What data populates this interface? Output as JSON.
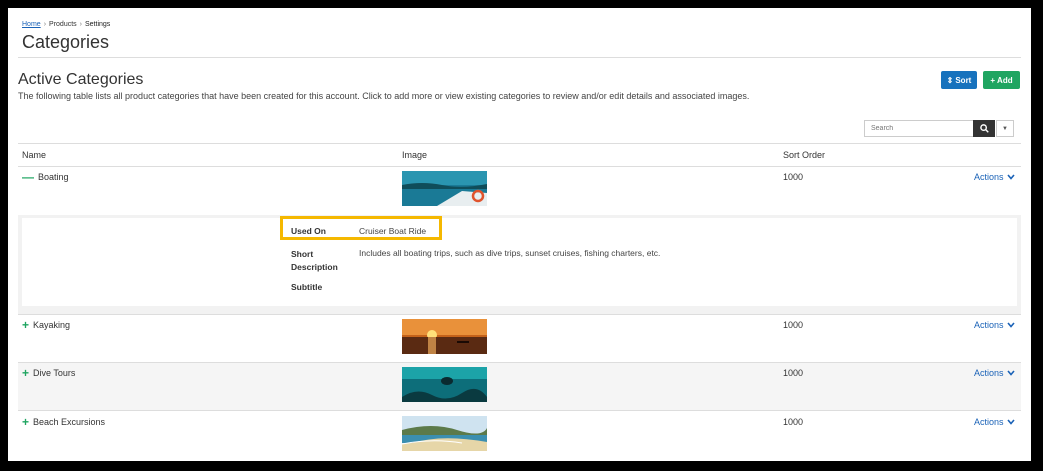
{
  "breadcrumb": {
    "home": "Home",
    "products": "Products",
    "settings": "Settings"
  },
  "page": {
    "title": "Categories"
  },
  "section": {
    "title": "Active Categories",
    "description": "The following table lists all product categories that have been created for this account. Click to add more or view existing categories to review and/or edit details and associated images."
  },
  "toolbar": {
    "sort_label": "Sort",
    "add_label": "Add"
  },
  "search": {
    "placeholder": "Search"
  },
  "table": {
    "headers": {
      "name": "Name",
      "image": "Image",
      "sort_order": "Sort Order"
    },
    "rows": [
      {
        "name": "Boating",
        "sort_order": "1000",
        "actions": "Actions",
        "expanded": true
      },
      {
        "name": "Kayaking",
        "sort_order": "1000",
        "actions": "Actions",
        "expanded": false
      },
      {
        "name": "Dive Tours",
        "sort_order": "1000",
        "actions": "Actions",
        "expanded": false
      },
      {
        "name": "Beach Excursions",
        "sort_order": "1000",
        "actions": "Actions",
        "expanded": false
      }
    ]
  },
  "detail": {
    "used_on_label": "Used On",
    "used_on_value": "Cruiser Boat Ride",
    "short_desc_label": "Short Description",
    "short_desc_value": "Includes all boating trips, such as dive trips, sunset cruises, fishing charters, etc.",
    "subtitle_label": "Subtitle"
  },
  "colors": {
    "primary": "#1772bd",
    "success": "#1fa561",
    "highlight": "#f5b800",
    "link": "#1a62b7"
  }
}
